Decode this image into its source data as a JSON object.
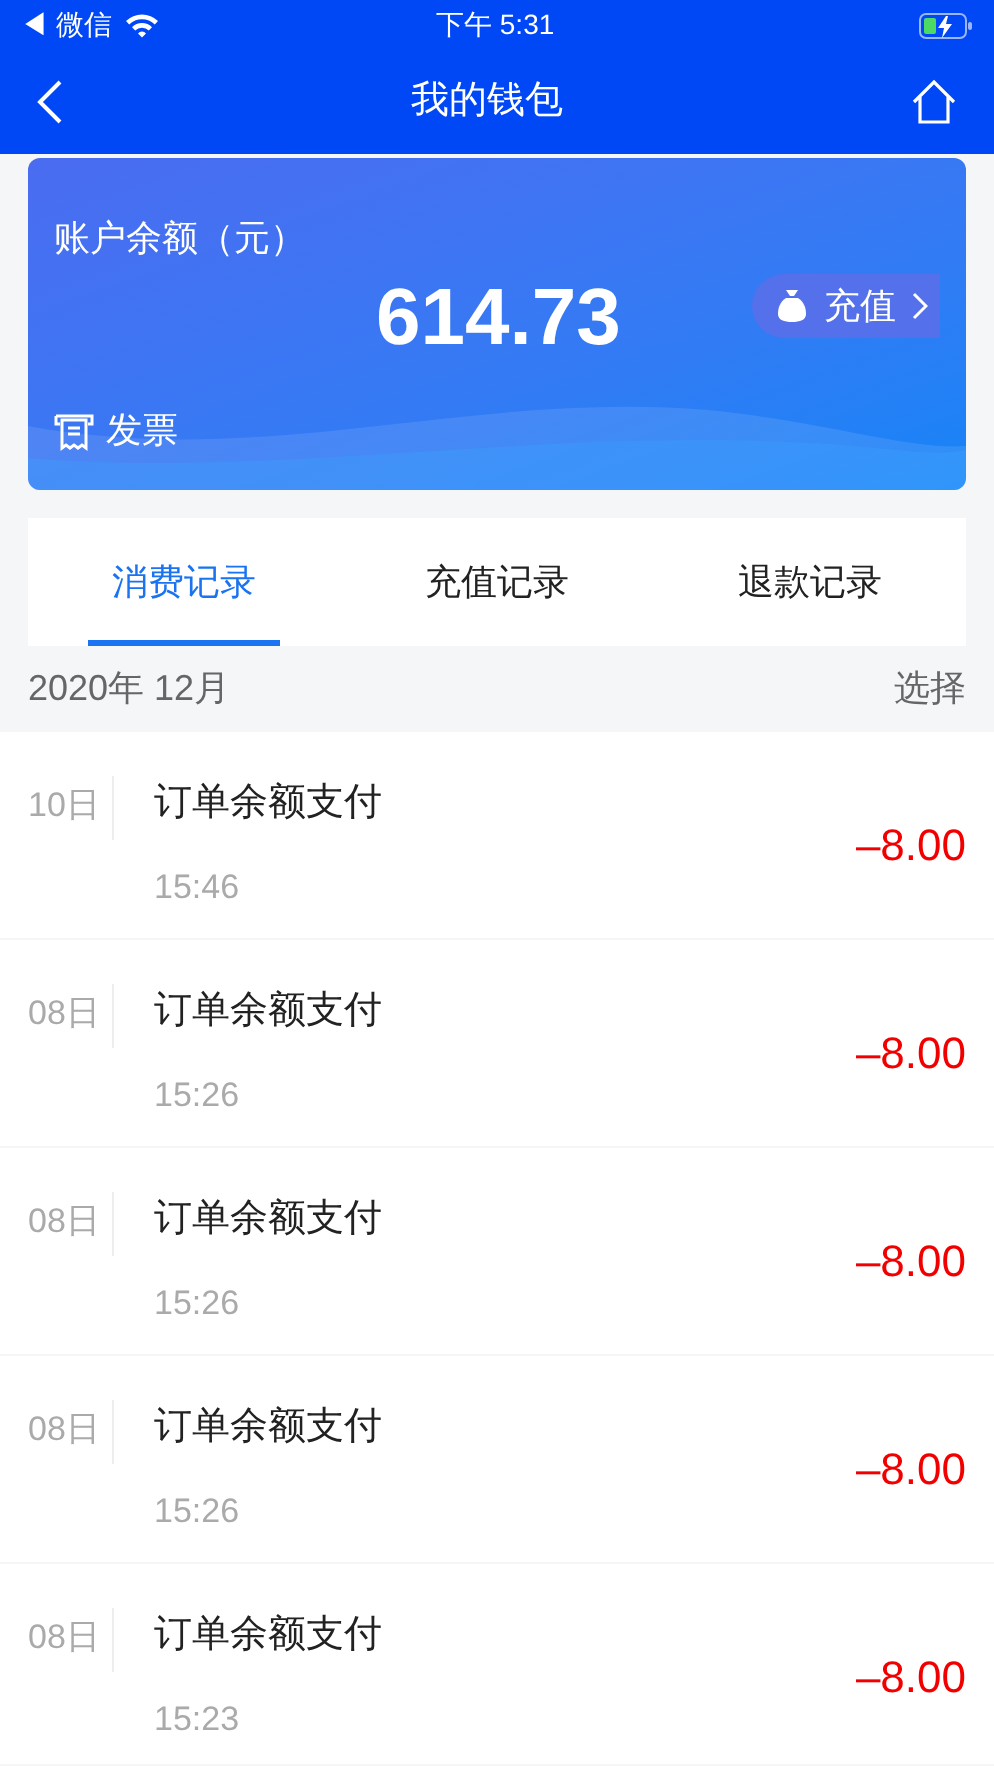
{
  "status_bar": {
    "back_app": "◀ 微信",
    "time": "下午 5:31"
  },
  "nav": {
    "title": "我的钱包"
  },
  "balance_card": {
    "label": "账户余额（元）",
    "amount": "614.73",
    "recharge": "充值",
    "invoice": "发票"
  },
  "tabs": [
    {
      "label": "消费记录",
      "selected": true
    },
    {
      "label": "充值记录",
      "selected": false
    },
    {
      "label": "退款记录",
      "selected": false
    }
  ],
  "month_header": {
    "month": "2020年 12月",
    "action": "选择"
  },
  "records": [
    {
      "day": "10日",
      "title": "订单余额支付",
      "time": "15:46",
      "amount": "–8.00"
    },
    {
      "day": "08日",
      "title": "订单余额支付",
      "time": "15:26",
      "amount": "–8.00"
    },
    {
      "day": "08日",
      "title": "订单余额支付",
      "time": "15:26",
      "amount": "–8.00"
    },
    {
      "day": "08日",
      "title": "订单余额支付",
      "time": "15:26",
      "amount": "–8.00"
    },
    {
      "day": "08日",
      "title": "订单余额支付",
      "time": "15:23",
      "amount": "–8.00"
    }
  ]
}
